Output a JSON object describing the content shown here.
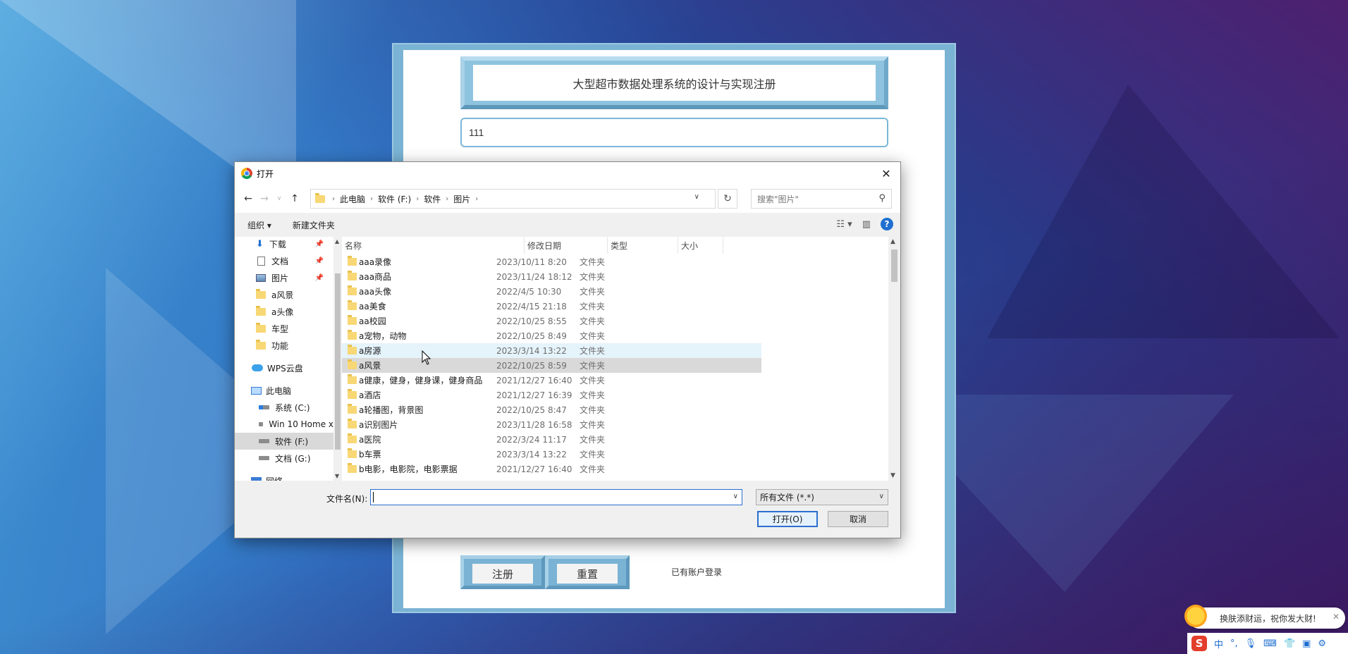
{
  "page": {
    "title": "大型超市数据处理系统的设计与实现注册",
    "username_value": "111",
    "register_label": "注册",
    "reset_label": "重置",
    "login_link": "已有账户登录"
  },
  "dialog": {
    "title": "打开",
    "close": "✕",
    "breadcrumb": [
      "此电脑",
      "软件 (F:)",
      "软件",
      "图片"
    ],
    "search_placeholder": "搜索\"图片\"",
    "toolbar": {
      "organize": "组织 ▾",
      "new_folder": "新建文件夹"
    },
    "nav": [
      {
        "label": "下载",
        "icon": "download-icon",
        "pinned": true
      },
      {
        "label": "文档",
        "icon": "document-icon",
        "pinned": true
      },
      {
        "label": "图片",
        "icon": "pictures-icon",
        "pinned": true
      },
      {
        "label": "a风景",
        "icon": "folder-icon"
      },
      {
        "label": "a头像",
        "icon": "folder-icon"
      },
      {
        "label": "车型",
        "icon": "folder-icon"
      },
      {
        "label": "功能",
        "icon": "folder-icon"
      },
      {
        "label": "WPS云盘",
        "icon": "cloud-icon"
      },
      {
        "label": "此电脑",
        "icon": "computer-icon"
      },
      {
        "label": "系统 (C:)",
        "icon": "drive-icon"
      },
      {
        "label": "Win 10 Home x",
        "icon": "drive-icon"
      },
      {
        "label": "软件 (F:)",
        "icon": "drive-icon",
        "selected": true
      },
      {
        "label": "文档 (G:)",
        "icon": "drive-icon"
      },
      {
        "label": "网络",
        "icon": "network-icon"
      }
    ],
    "columns": {
      "name": "名称",
      "date": "修改日期",
      "type": "类型",
      "size": "大小"
    },
    "files": [
      {
        "name": "aaa录像",
        "date": "2023/10/11 8:20",
        "type": "文件夹"
      },
      {
        "name": "aaa商品",
        "date": "2023/11/24 18:12",
        "type": "文件夹"
      },
      {
        "name": "aaa头像",
        "date": "2022/4/5 10:30",
        "type": "文件夹"
      },
      {
        "name": "aa美食",
        "date": "2022/4/15 21:18",
        "type": "文件夹"
      },
      {
        "name": "aa校园",
        "date": "2022/10/25 8:55",
        "type": "文件夹"
      },
      {
        "name": "a宠物，动物",
        "date": "2022/10/25 8:49",
        "type": "文件夹"
      },
      {
        "name": "a房源",
        "date": "2023/3/14 13:22",
        "type": "文件夹",
        "state": "hover"
      },
      {
        "name": "a风景",
        "date": "2022/10/25 8:59",
        "type": "文件夹",
        "state": "selected"
      },
      {
        "name": "a健康，健身，健身课，健身商品",
        "date": "2021/12/27 16:40",
        "type": "文件夹"
      },
      {
        "name": "a酒店",
        "date": "2021/12/27 16:39",
        "type": "文件夹"
      },
      {
        "name": "a轮播图，背景图",
        "date": "2022/10/25 8:47",
        "type": "文件夹"
      },
      {
        "name": "a识别图片",
        "date": "2023/11/28 16:58",
        "type": "文件夹"
      },
      {
        "name": "a医院",
        "date": "2022/3/24 11:17",
        "type": "文件夹"
      },
      {
        "name": "b车票",
        "date": "2023/3/14 13:22",
        "type": "文件夹"
      },
      {
        "name": "b电影，电影院，电影票据",
        "date": "2021/12/27 16:40",
        "type": "文件夹"
      }
    ],
    "filename_label": "文件名(N):",
    "filename_value": "",
    "filter": "所有文件 (*.*)",
    "open_label": "打开(O)",
    "cancel_label": "取消"
  },
  "ime": {
    "bubble_text": "换肤添财运，祝你发大财!",
    "mode": "中"
  }
}
